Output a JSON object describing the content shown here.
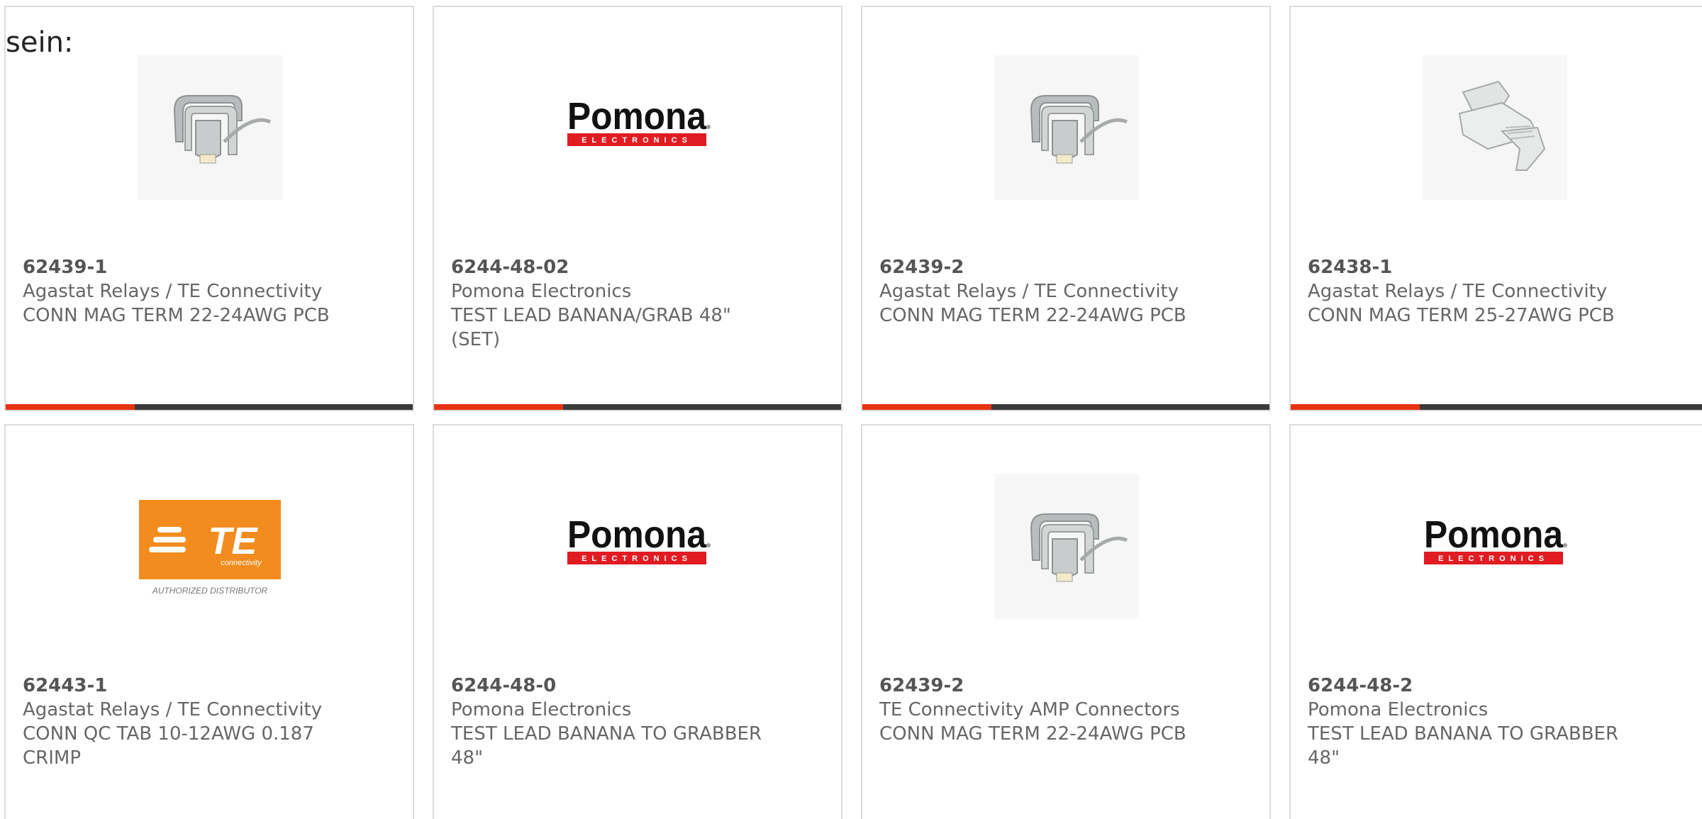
{
  "heading": "sein:",
  "colors": {
    "accent": "#e63312",
    "bar": "#3a3a3a",
    "pomona_red": "#e11b22",
    "te_orange": "#f28c1e"
  },
  "products": [
    {
      "part_number": "62439-1",
      "manufacturer": "Agastat Relays / TE Connectivity",
      "description": "CONN MAG TERM 22-24AWG PCB",
      "image": "clip-terminal-icon"
    },
    {
      "part_number": "6244-48-02",
      "manufacturer": "Pomona Electronics",
      "description": "TEST LEAD BANANA/GRAB 48\" (SET)",
      "image": "pomona-logo"
    },
    {
      "part_number": "62439-2",
      "manufacturer": "Agastat Relays / TE Connectivity",
      "description": "CONN MAG TERM 22-24AWG PCB",
      "image": "clip-terminal-icon"
    },
    {
      "part_number": "62438-1",
      "manufacturer": "Agastat Relays / TE Connectivity",
      "description": "CONN MAG TERM 25-27AWG PCB",
      "image": "clip-terminal-icon"
    },
    {
      "part_number": "62443-1",
      "manufacturer": "Agastat Relays / TE Connectivity",
      "description": "CONN QC TAB 10-12AWG 0.187 CRIMP",
      "image": "te-connectivity-logo"
    },
    {
      "part_number": "6244-48-0",
      "manufacturer": "Pomona Electronics",
      "description": "TEST LEAD BANANA TO GRABBER 48\"",
      "image": "pomona-logo"
    },
    {
      "part_number": "62439-2",
      "manufacturer": "TE Connectivity AMP Connectors",
      "description": "CONN MAG TERM 22-24AWG PCB",
      "image": "clip-terminal-icon"
    },
    {
      "part_number": "6244-48-2",
      "manufacturer": "Pomona Electronics",
      "description": "TEST LEAD BANANA TO GRABBER 48\"",
      "image": "pomona-logo"
    }
  ],
  "logos": {
    "pomona_main": "Pomona",
    "pomona_dot": ".",
    "pomona_sub": "ELECTRONICS",
    "te_main": "TE",
    "te_sub": "connectivity",
    "te_caption": "AUTHORIZED DISTRIBUTOR"
  }
}
